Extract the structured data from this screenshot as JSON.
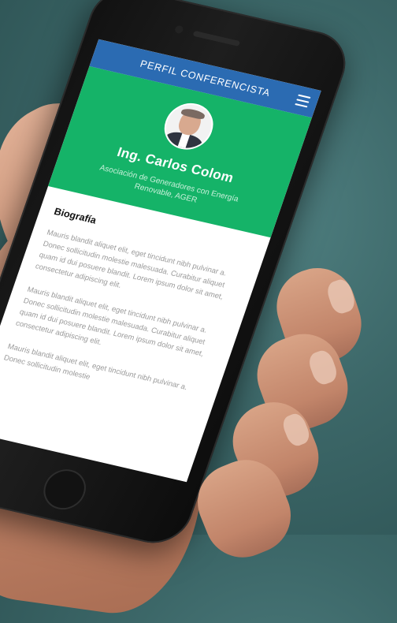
{
  "topbar": {
    "title": "PERFIL CONFERENCISTA",
    "menu_icon": "hamburger-menu-icon"
  },
  "profile": {
    "name": "Ing. Carlos Colom",
    "organization": "Asociación de Generadores con Energía Renovable, AGER"
  },
  "biography": {
    "heading": "Biografía",
    "paragraphs": [
      "Mauris blandit aliquet elit, eget tincidunt nibh pulvinar a. Donec sollicitudin molestie malesuada. Curabitur aliquet quam id dui posuere blandit. Lorem ipsum dolor sit amet, consectetur adipiscing elit.",
      "Mauris blandit aliquet elit, eget tincidunt nibh pulvinar a. Donec sollicitudin molestie malesuada. Curabitur aliquet quam id dui posuere blandit. Lorem ipsum dolor sit amet, consectetur adipiscing elit.",
      "Mauris blandit aliquet elit, eget tincidunt nibh pulvinar a. Donec sollicitudin molestie"
    ]
  },
  "colors": {
    "topbar": "#2b6bb2",
    "header": "#15b368"
  }
}
